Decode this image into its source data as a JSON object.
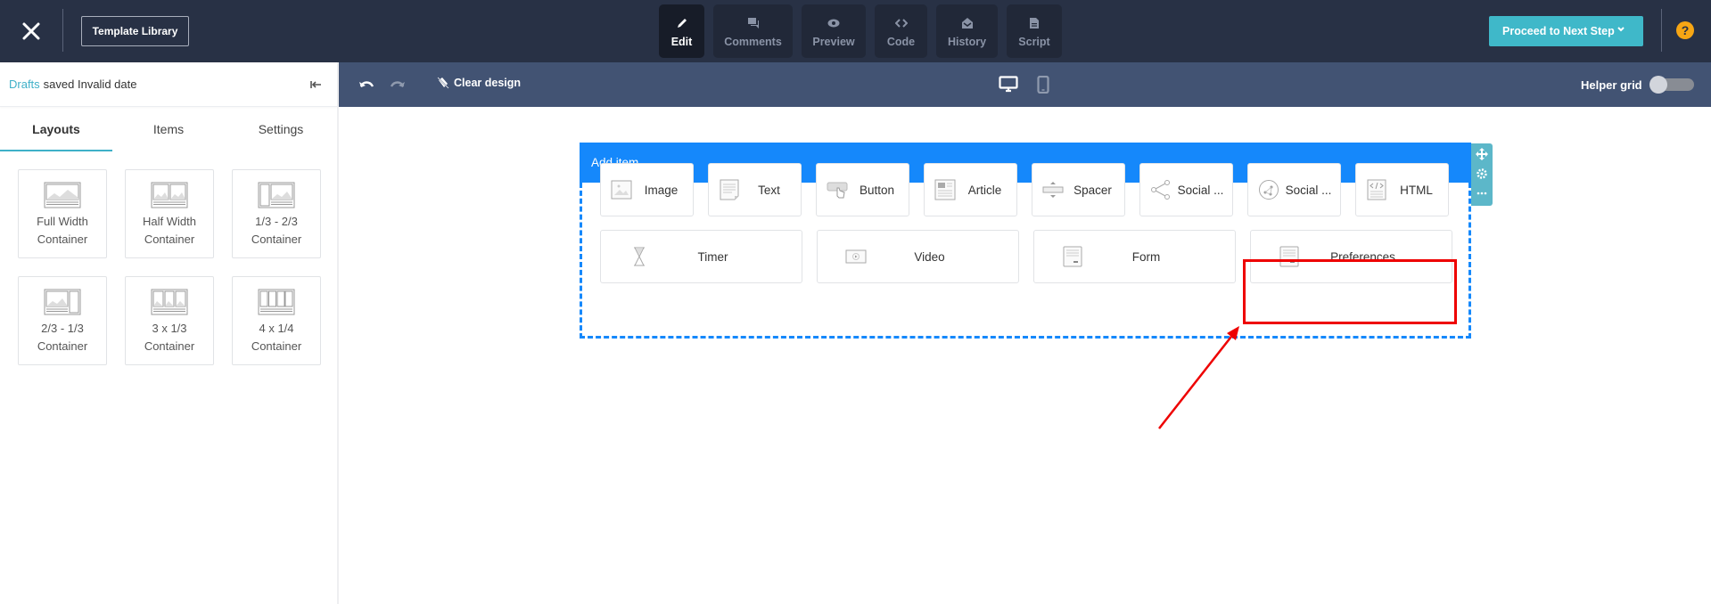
{
  "topbar": {
    "close_icon": "close-icon",
    "template_library_label": "Template Library",
    "modes": [
      {
        "label": "Edit",
        "icon": "pencil-icon",
        "active": true
      },
      {
        "label": "Comments",
        "icon": "comments-icon",
        "active": false
      },
      {
        "label": "Preview",
        "icon": "eye-icon",
        "active": false
      },
      {
        "label": "Code",
        "icon": "code-icon",
        "active": false
      },
      {
        "label": "History",
        "icon": "envelope-open-icon",
        "active": false
      },
      {
        "label": "Script",
        "icon": "file-icon",
        "active": false
      }
    ],
    "proceed_label": "Proceed to Next Step",
    "help_label": "?"
  },
  "sidebar": {
    "drafts_link": "Drafts",
    "drafts_status": "saved Invalid date",
    "tabs": [
      {
        "label": "Layouts",
        "active": true
      },
      {
        "label": "Items",
        "active": false
      },
      {
        "label": "Settings",
        "active": false
      }
    ],
    "layouts": [
      {
        "line1": "Full Width",
        "line2": "Container"
      },
      {
        "line1": "Half Width",
        "line2": "Container"
      },
      {
        "line1": "1/3 - 2/3",
        "line2": "Container"
      },
      {
        "line1": "2/3 - 1/3",
        "line2": "Container"
      },
      {
        "line1": "3 x 1/3",
        "line2": "Container"
      },
      {
        "line1": "4 x 1/4",
        "line2": "Container"
      }
    ]
  },
  "toolbar": {
    "clear_design_label": "Clear design",
    "helper_grid_label": "Helper grid",
    "helper_grid_on": false
  },
  "canvas": {
    "block_header": "Add item",
    "items_row1": [
      {
        "label": "Image",
        "icon": "image-icon"
      },
      {
        "label": "Text",
        "icon": "text-icon"
      },
      {
        "label": "Button",
        "icon": "button-icon"
      },
      {
        "label": "Article",
        "icon": "article-icon"
      },
      {
        "label": "Spacer",
        "icon": "spacer-icon"
      },
      {
        "label": "Social ...",
        "icon": "share-icon"
      },
      {
        "label": "Social ...",
        "icon": "social-network-icon"
      },
      {
        "label": "HTML",
        "icon": "html-icon"
      }
    ],
    "items_row2": [
      {
        "label": "Timer",
        "icon": "hourglass-icon"
      },
      {
        "label": "Video",
        "icon": "video-icon"
      },
      {
        "label": "Form",
        "icon": "form-icon"
      },
      {
        "label": "Preferences",
        "icon": "preferences-icon",
        "highlighted": true
      }
    ]
  },
  "annotation": {
    "highlight_color": "#ee0000",
    "target": "Preferences"
  },
  "colors": {
    "topbar_bg": "#283145",
    "subbar_bg": "#425373",
    "accent": "#3fb8c9",
    "block_blue": "#1588fb",
    "help_orange": "#f7a614"
  }
}
